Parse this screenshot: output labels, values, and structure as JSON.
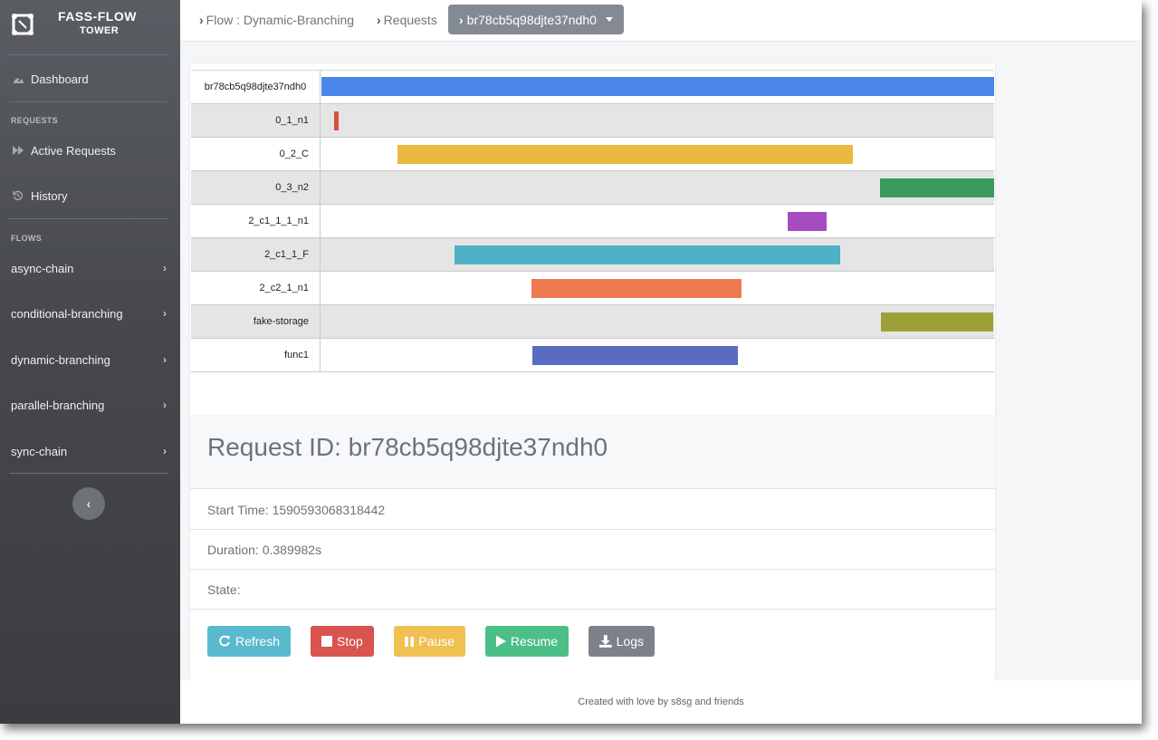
{
  "brand": {
    "title": "FASS-FLOW",
    "subtitle": "TOWER"
  },
  "sidebar": {
    "dashboard": "Dashboard",
    "requests_section": "REQUESTS",
    "active_requests": "Active Requests",
    "history": "History",
    "flows_section": "FLOWS",
    "flows": [
      "async-chain",
      "conditional-branching",
      "dynamic-branching",
      "parallel-branching",
      "sync-chain"
    ]
  },
  "breadcrumb": {
    "flow": "Flow : Dynamic-Branching",
    "requests": "Requests",
    "current": "br78cb5q98djte37ndh0"
  },
  "gantt": {
    "rows": [
      {
        "label": "br78cb5q98djte37ndh0",
        "start": 0.0,
        "end": 1.0,
        "color": "#4a86e8"
      },
      {
        "label": "0_1_n1",
        "start": 0.019,
        "end": 0.026,
        "color": "#d9503f"
      },
      {
        "label": "0_2_C",
        "start": 0.113,
        "end": 0.79,
        "color": "#ecb93f"
      },
      {
        "label": "0_3_n2",
        "start": 0.831,
        "end": 1.0,
        "color": "#3a9b5a"
      },
      {
        "label": "2_c1_1_1_n1",
        "start": 0.693,
        "end": 0.751,
        "color": "#a54cc0"
      },
      {
        "label": "2_c1_1_F",
        "start": 0.198,
        "end": 0.771,
        "color": "#4eb1c6"
      },
      {
        "label": "2_c2_1_n1",
        "start": 0.312,
        "end": 0.624,
        "color": "#ef7a4f"
      },
      {
        "label": "fake-storage",
        "start": 0.832,
        "end": 0.998,
        "color": "#a0a03b"
      },
      {
        "label": "func1",
        "start": 0.314,
        "end": 0.619,
        "color": "#5a6bc2"
      }
    ]
  },
  "request": {
    "title": "Request ID: br78cb5q98djte37ndh0",
    "start_time": "Start Time: 1590593068318442",
    "duration": "Duration: 0.389982s",
    "state": "State:"
  },
  "buttons": {
    "refresh": "Refresh",
    "stop": "Stop",
    "pause": "Pause",
    "resume": "Resume",
    "logs": "Logs"
  },
  "footer": "Created with love by s8sg and friends"
}
